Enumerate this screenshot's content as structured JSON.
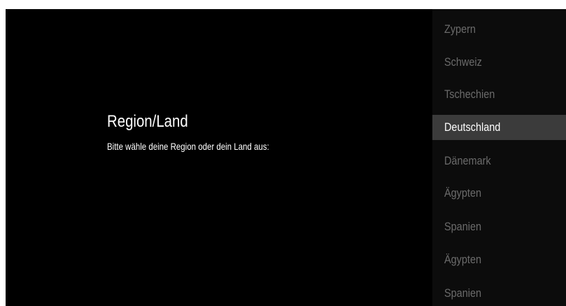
{
  "dialog": {
    "title": "Region/Land",
    "subtitle": "Bitte wähle deine Region oder dein Land aus:"
  },
  "country_list": {
    "selected_index": 3,
    "items": [
      {
        "label": "Zypern"
      },
      {
        "label": "Schweiz"
      },
      {
        "label": "Tschechien"
      },
      {
        "label": "Deutschland"
      },
      {
        "label": "Dänemark"
      },
      {
        "label": "Ägypten"
      },
      {
        "label": "Spanien"
      },
      {
        "label": "Ägypten"
      },
      {
        "label": "Spanien"
      }
    ]
  },
  "colors": {
    "background": "#000000",
    "list_background": "#0c0c0c",
    "selected_background": "#3b3b3b",
    "selected_text": "#ffffff",
    "unselected_text": "#6b6b6b"
  }
}
